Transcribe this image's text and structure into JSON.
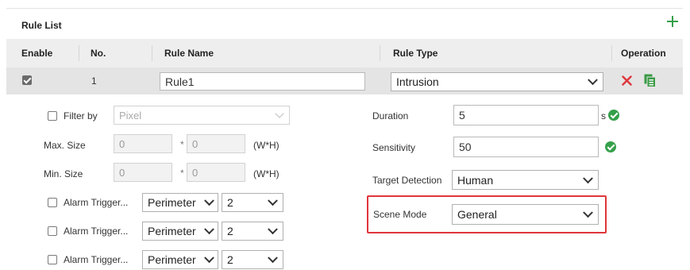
{
  "title": "Rule List",
  "columns": {
    "enable": "Enable",
    "no": "No.",
    "rule_name": "Rule Name",
    "rule_type": "Rule Type",
    "operation": "Operation"
  },
  "rule": {
    "enabled": true,
    "no": "1",
    "name": "Rule1",
    "type": "Intrusion"
  },
  "filter": {
    "label": "Filter by",
    "value": "Pixel",
    "checked": false
  },
  "max_size": {
    "label": "Max. Size",
    "w": "0",
    "sep": "*",
    "h": "0",
    "unit": "(W*H)"
  },
  "min_size": {
    "label": "Min. Size",
    "w": "0",
    "sep": "*",
    "h": "0",
    "unit": "(W*H)"
  },
  "alarm_triggers": [
    {
      "label": "Alarm Trigger...",
      "mode": "Perimeter",
      "count": "2",
      "checked": false
    },
    {
      "label": "Alarm Trigger...",
      "mode": "Perimeter",
      "count": "2",
      "checked": false
    },
    {
      "label": "Alarm Trigger...",
      "mode": "Perimeter",
      "count": "2",
      "checked": false
    }
  ],
  "duration": {
    "label": "Duration",
    "value": "5",
    "unit": "s"
  },
  "sensitivity": {
    "label": "Sensitivity",
    "value": "50"
  },
  "target_detection": {
    "label": "Target Detection",
    "value": "Human"
  },
  "scene_mode": {
    "label": "Scene Mode",
    "value": "General"
  },
  "colors": {
    "accent_green": "#35a04a",
    "delete_red": "#e0353c",
    "highlight_red": "#e0353c"
  },
  "icons": {
    "add": "plus-icon",
    "delete": "close-icon",
    "copy": "copy-icon",
    "valid": "check-circle-icon"
  }
}
